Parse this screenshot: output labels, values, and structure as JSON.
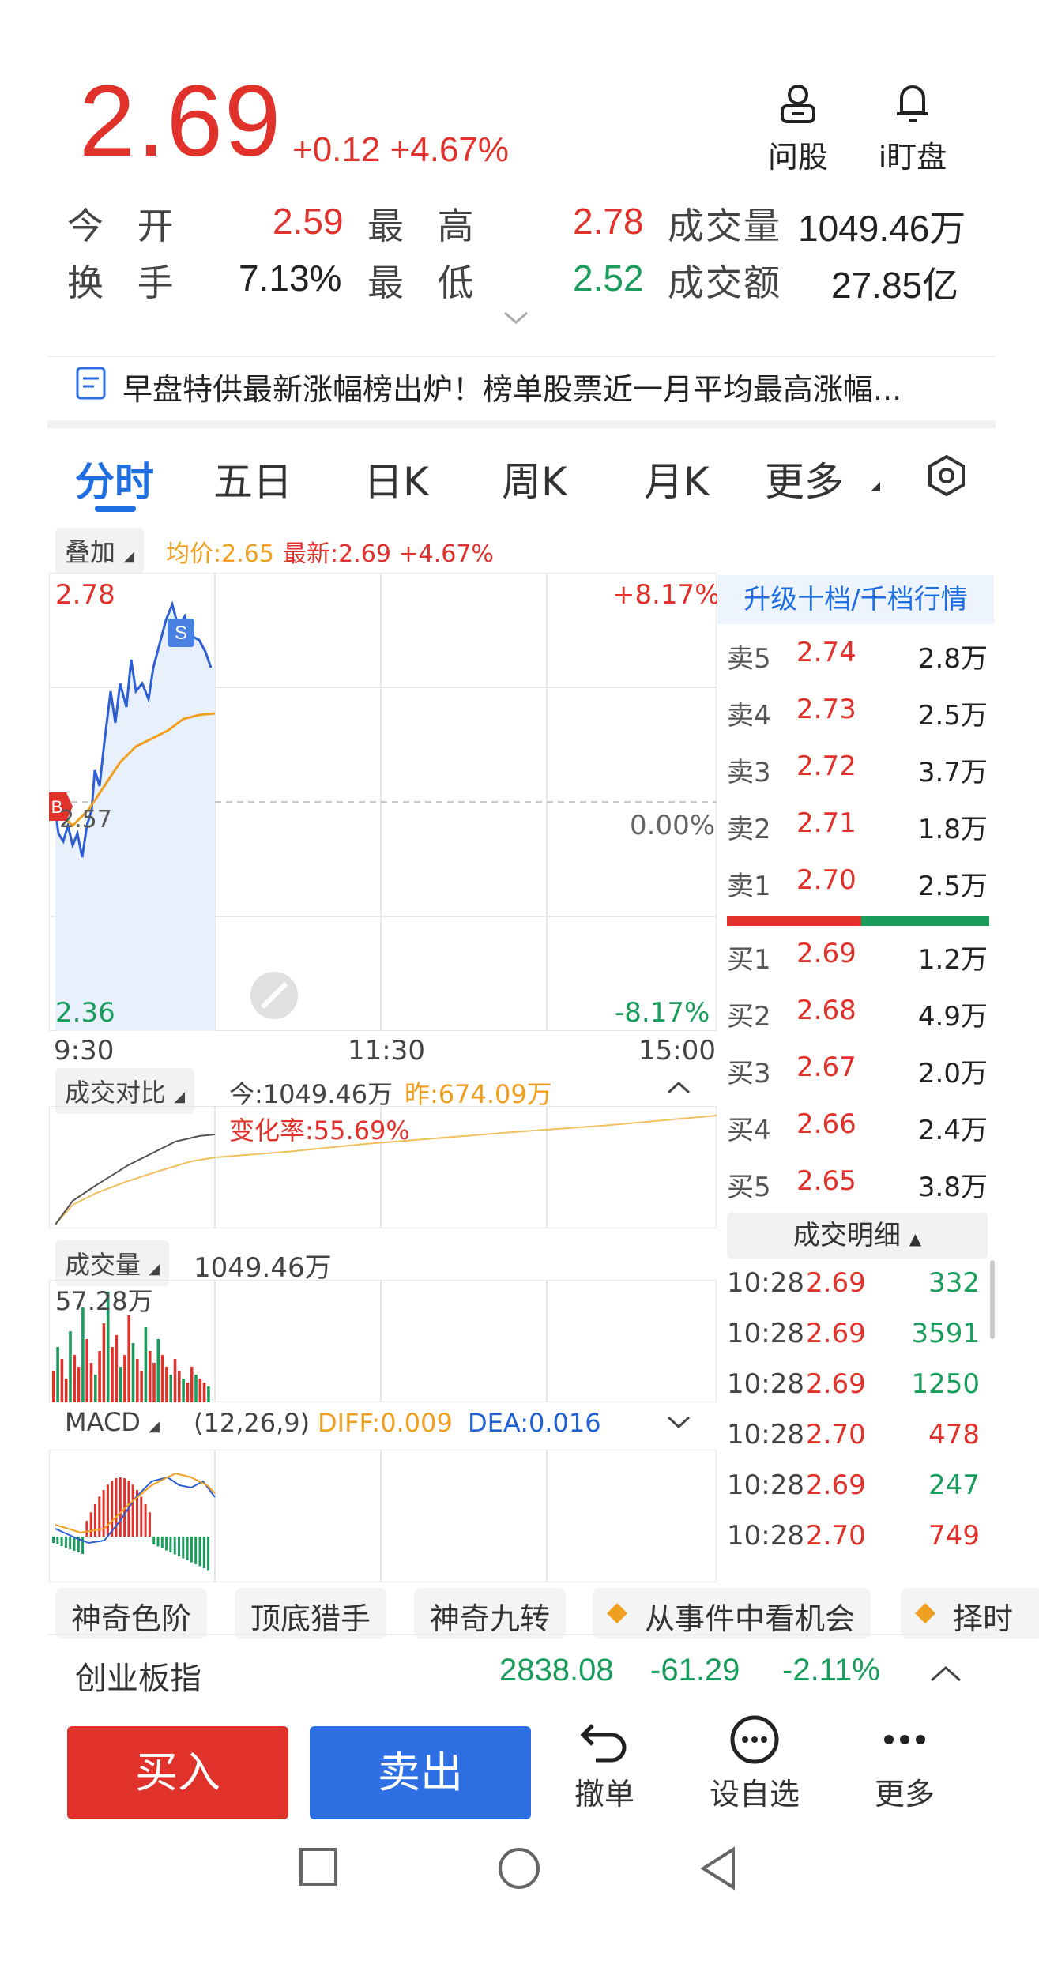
{
  "header": {
    "price": "2.69",
    "change": "+0.12 +4.67%",
    "btn_ask_stock": "问股",
    "btn_watch": "i盯盘"
  },
  "stats": {
    "open_label": "今 开",
    "open_value": "2.59",
    "high_label": "最 高",
    "high_value": "2.78",
    "volume_label": "成交量",
    "volume_value": "1049.46万",
    "turnover_label": "换 手",
    "turnover_value": "7.13%",
    "low_label": "最 低",
    "low_value": "2.52",
    "amount_label": "成交额",
    "amount_value": "27.85亿"
  },
  "news": {
    "text": "早盘特供最新涨幅榜出炉！榜单股票近一月平均最高涨幅..."
  },
  "tabs": [
    "分时",
    "五日",
    "日K",
    "周K",
    "月K",
    "更多"
  ],
  "chart": {
    "overlay_btn": "叠加",
    "avg_price": "均价:2.65",
    "latest": "最新:2.69 +4.67%",
    "y_high": "2.78",
    "y_low": "2.36",
    "pct_high": "+8.17%",
    "pct_zero": "0.00%",
    "pct_low": "-8.17%",
    "y_mid": "2.57",
    "t_start": "9:30",
    "t_mid": "11:30",
    "t_end": "15:00",
    "vol_compare_btn": "成交对比",
    "today_vol": "今:1049.46万",
    "yest_vol": "昨:674.09万",
    "change_rate": "变化率:55.69%",
    "vol_btn": "成交量",
    "vol_total": "1049.46万",
    "vol_max": "57.28万",
    "macd_btn": "MACD",
    "macd_params": "(12,26,9)",
    "diff": "DIFF:0.009",
    "dea": "DEA:0.016"
  },
  "orderbook": {
    "upgrade": "升级十档/千档行情",
    "sells": [
      {
        "label": "卖5",
        "price": "2.74",
        "vol": "2.8万"
      },
      {
        "label": "卖4",
        "price": "2.73",
        "vol": "2.5万"
      },
      {
        "label": "卖3",
        "price": "2.72",
        "vol": "3.7万"
      },
      {
        "label": "卖2",
        "price": "2.71",
        "vol": "1.8万"
      },
      {
        "label": "卖1",
        "price": "2.70",
        "vol": "2.5万"
      }
    ],
    "buys": [
      {
        "label": "买1",
        "price": "2.69",
        "vol": "1.2万"
      },
      {
        "label": "买2",
        "price": "2.68",
        "vol": "4.9万"
      },
      {
        "label": "买3",
        "price": "2.67",
        "vol": "2.0万"
      },
      {
        "label": "买4",
        "price": "2.66",
        "vol": "2.4万"
      },
      {
        "label": "买5",
        "price": "2.65",
        "vol": "3.8万"
      }
    ],
    "detail_btn": "成交明细",
    "ticks": [
      {
        "time": "10:28",
        "price": "2.69",
        "vol": "332",
        "dir": "green"
      },
      {
        "time": "10:28",
        "price": "2.69",
        "vol": "3591",
        "dir": "green"
      },
      {
        "time": "10:28",
        "price": "2.69",
        "vol": "1250",
        "dir": "green"
      },
      {
        "time": "10:28",
        "price": "2.70",
        "vol": "478",
        "dir": "red"
      },
      {
        "time": "10:28",
        "price": "2.69",
        "vol": "247",
        "dir": "green"
      },
      {
        "time": "10:28",
        "price": "2.70",
        "vol": "749",
        "dir": "red"
      }
    ]
  },
  "chips": [
    "神奇色阶",
    "顶底猎手",
    "神奇九转",
    "从事件中看机会",
    "择时"
  ],
  "index": {
    "name": "创业板指",
    "value": "2838.08",
    "change": "-61.29",
    "pct": "-2.11%"
  },
  "actions": {
    "buy": "买入",
    "sell": "卖出",
    "cancel": "撤单",
    "watchlist": "设自选",
    "more": "更多"
  }
}
